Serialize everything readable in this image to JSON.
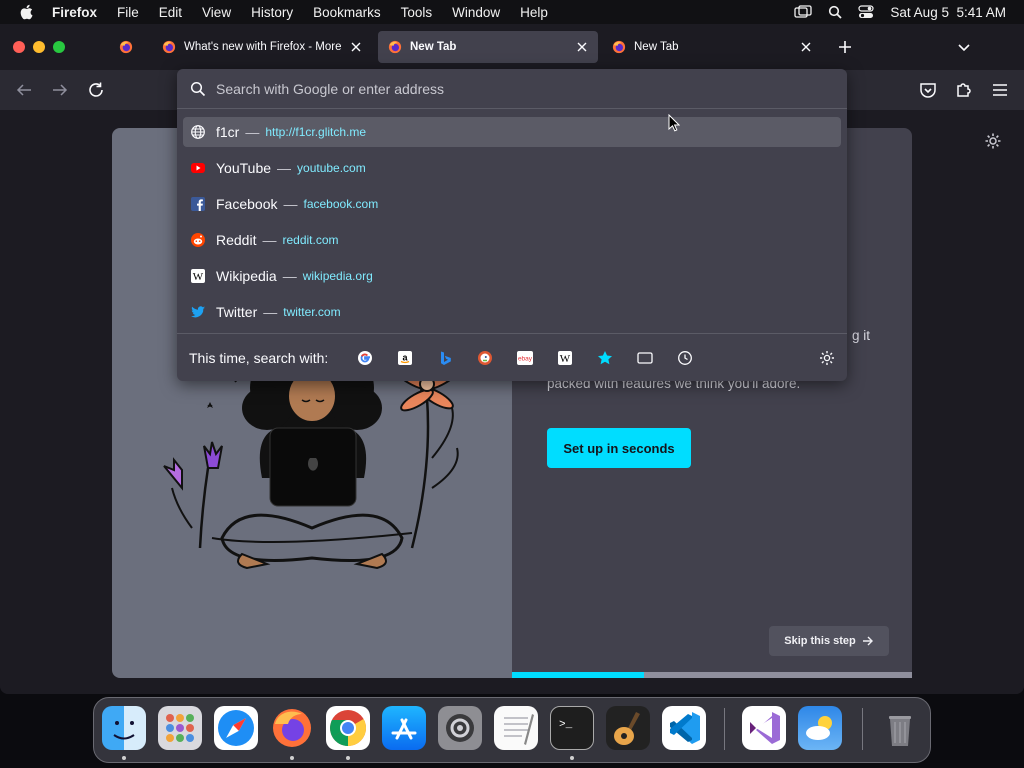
{
  "menubar": {
    "app_name": "Firefox",
    "items": [
      "File",
      "Edit",
      "View",
      "History",
      "Bookmarks",
      "Tools",
      "Window",
      "Help"
    ],
    "clock": "Sat Aug 5  5:41 AM"
  },
  "tabs": [
    {
      "label": "What's new with Firefox - More"
    },
    {
      "label": "New Tab"
    },
    {
      "label": "New Tab"
    }
  ],
  "urlbar": {
    "placeholder": "Search with Google or enter address",
    "results": [
      {
        "title": "f1cr",
        "url": "http://f1cr.glitch.me",
        "icon": "globe-icon"
      },
      {
        "title": "YouTube",
        "url": "youtube.com",
        "icon": "youtube-icon"
      },
      {
        "title": "Facebook",
        "url": "facebook.com",
        "icon": "facebook-icon"
      },
      {
        "title": "Reddit",
        "url": "reddit.com",
        "icon": "reddit-icon"
      },
      {
        "title": "Wikipedia",
        "url": "wikipedia.org",
        "icon": "wikipedia-icon"
      },
      {
        "title": "Twitter",
        "url": "twitter.com",
        "icon": "twitter-icon"
      }
    ],
    "separator": "—",
    "search_with_label": "This time, search with:",
    "engines": [
      "google-icon",
      "amazon-icon",
      "bing-icon",
      "duckduckgo-icon",
      "ebay-icon",
      "wikipedia-icon",
      "bookmarks-star-icon",
      "tabs-icon",
      "history-icon"
    ]
  },
  "onboarding": {
    "subtitle_tail": "g it",
    "subtitle": "packed with features we think you'll adore.",
    "cta_label": "Set up in seconds",
    "skip_label": "Skip this step",
    "progress": 0.33
  },
  "colors": {
    "accent": "#00ddff",
    "url_text": "#80ebff",
    "panel_bg": "#42414d",
    "illustration_bg": "#6b6f7d"
  },
  "dock": {
    "apps": [
      "finder-icon",
      "launchpad-icon",
      "safari-icon",
      "firefox-icon",
      "chrome-icon",
      "app-store-icon",
      "system-settings-icon",
      "textedit-icon",
      "terminal-icon",
      "garageband-icon",
      "vscode-icon",
      "visual-studio-icon",
      "weather-icon",
      "trash-icon"
    ]
  }
}
